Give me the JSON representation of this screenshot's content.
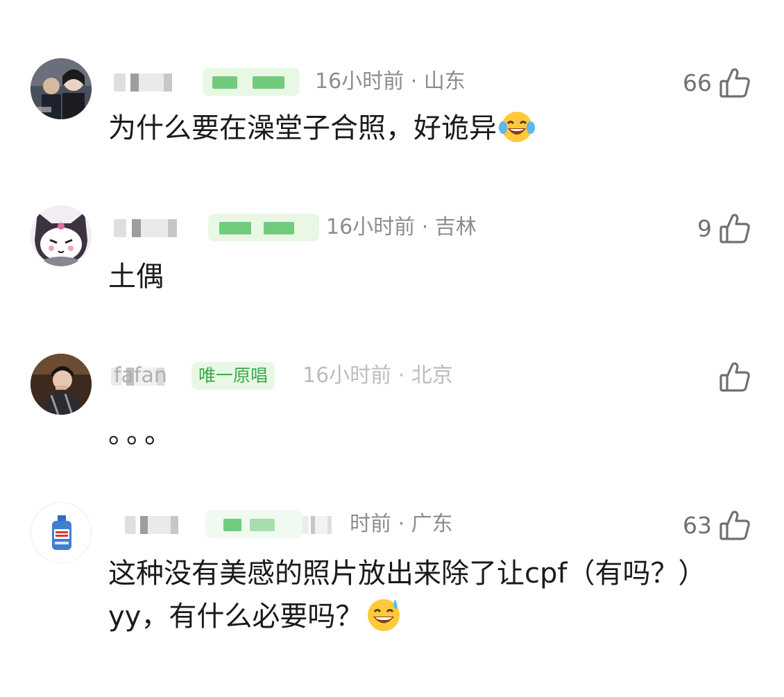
{
  "comments": [
    {
      "meta": "16小时前 · 山东",
      "likes": "66",
      "text": "为什么要在澡堂子合照，好诡异",
      "emoji": "tears-of-joy-emoji"
    },
    {
      "meta": "16小时前 · 吉林",
      "likes": "9",
      "text": "土偶"
    },
    {
      "name": "fafan",
      "badge": "唯一原唱",
      "meta": "16小时前 · 北京",
      "likes": "",
      "text": "。。。"
    },
    {
      "meta": "时前 · 广东",
      "likes": "63",
      "text": "这种没有美感的照片放出来除了让cpf（有吗？）yy，有什么必要吗？",
      "emoji": "grinning-sweat-emoji"
    }
  ],
  "icons": {
    "like": "thumbs-up-icon"
  },
  "colors": {
    "badge_bg": "#e8f8e4",
    "badge_text": "#3ba84a",
    "meta": "#8c8c8c",
    "body": "#1a1a1a"
  }
}
